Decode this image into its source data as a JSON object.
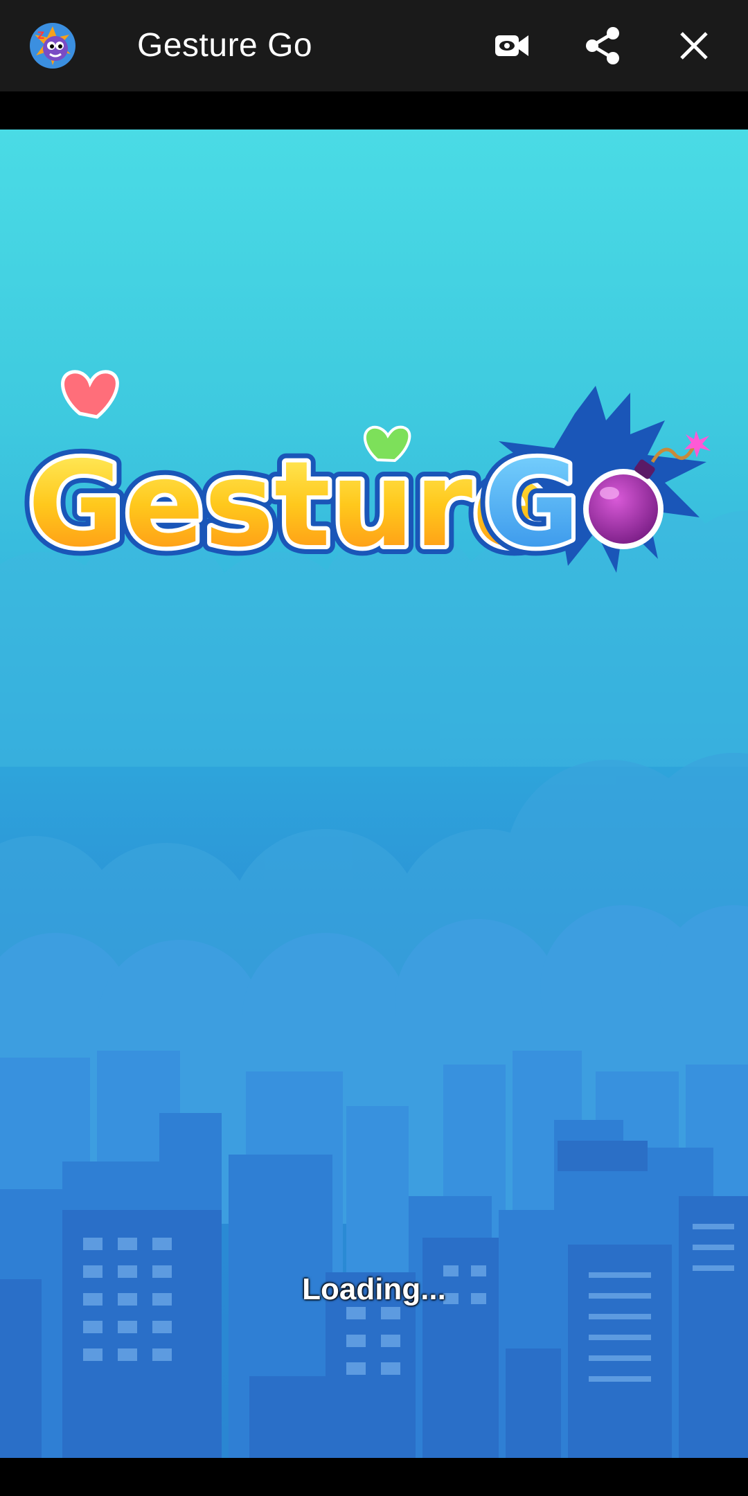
{
  "toolbar": {
    "title": "Gesture Go",
    "app_icon": "game-monster-icon",
    "actions": [
      {
        "name": "record-video-icon"
      },
      {
        "name": "share-icon"
      },
      {
        "name": "close-icon"
      }
    ],
    "background_color": "#1a1a1a"
  },
  "game": {
    "logo": {
      "word1": "Gesture",
      "word2": "Go",
      "colors": {
        "yellow": "#ffd21a",
        "orange": "#ff9a1c",
        "blue": "#3aa5ee",
        "bomb": "#9b2a9e",
        "outline": "#1a56b8"
      }
    },
    "loading_text": "Loading..."
  }
}
